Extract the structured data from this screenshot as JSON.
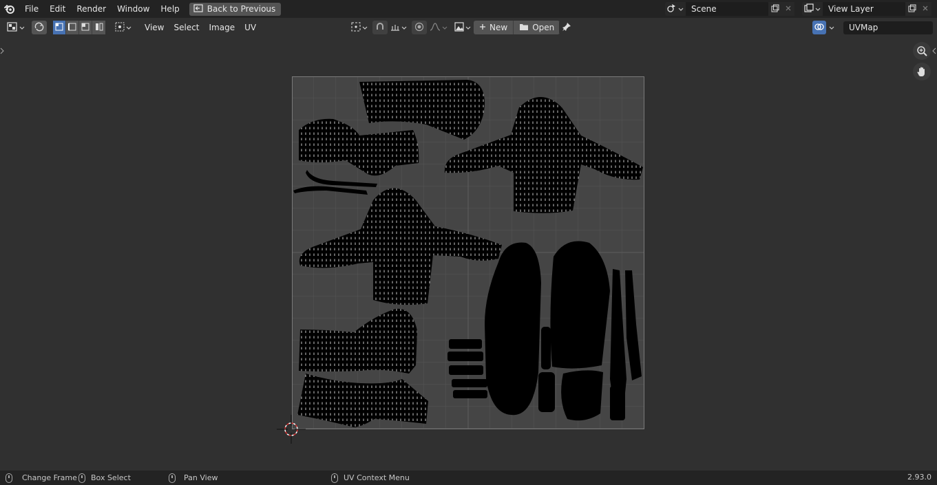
{
  "topbar": {
    "menu": [
      "File",
      "Edit",
      "Render",
      "Window",
      "Help"
    ],
    "back_label": "Back to Previous",
    "scene_name": "Scene",
    "view_layer_name": "View Layer"
  },
  "toolbar": {
    "menu": [
      "View",
      "Select",
      "Image",
      "UV"
    ],
    "new_label": "New",
    "open_label": "Open",
    "uvmap_name": "UVMap"
  },
  "statusbar": {
    "items": [
      "Change Frame",
      "Box Select",
      "Pan View",
      "UV Context Menu"
    ],
    "version": "2.93.0"
  },
  "icons": {
    "blender": "blender-logo-icon",
    "editor": "uv-editor-icon",
    "sync": "uv-sync-icon",
    "pivot": "pivot-icon",
    "snap": "snap-icon",
    "proportional": "proportional-edit-icon",
    "image": "image-icon",
    "pin": "pin-icon",
    "overlay": "overlay-icon",
    "zoom": "zoom-icon",
    "hand": "hand-icon"
  },
  "colors": {
    "accent": "#4772b3",
    "header": "#232323",
    "viewport": "#303030",
    "grid_bg": "#454545",
    "uv_islands": "#000000",
    "cursor": "#e03030"
  }
}
